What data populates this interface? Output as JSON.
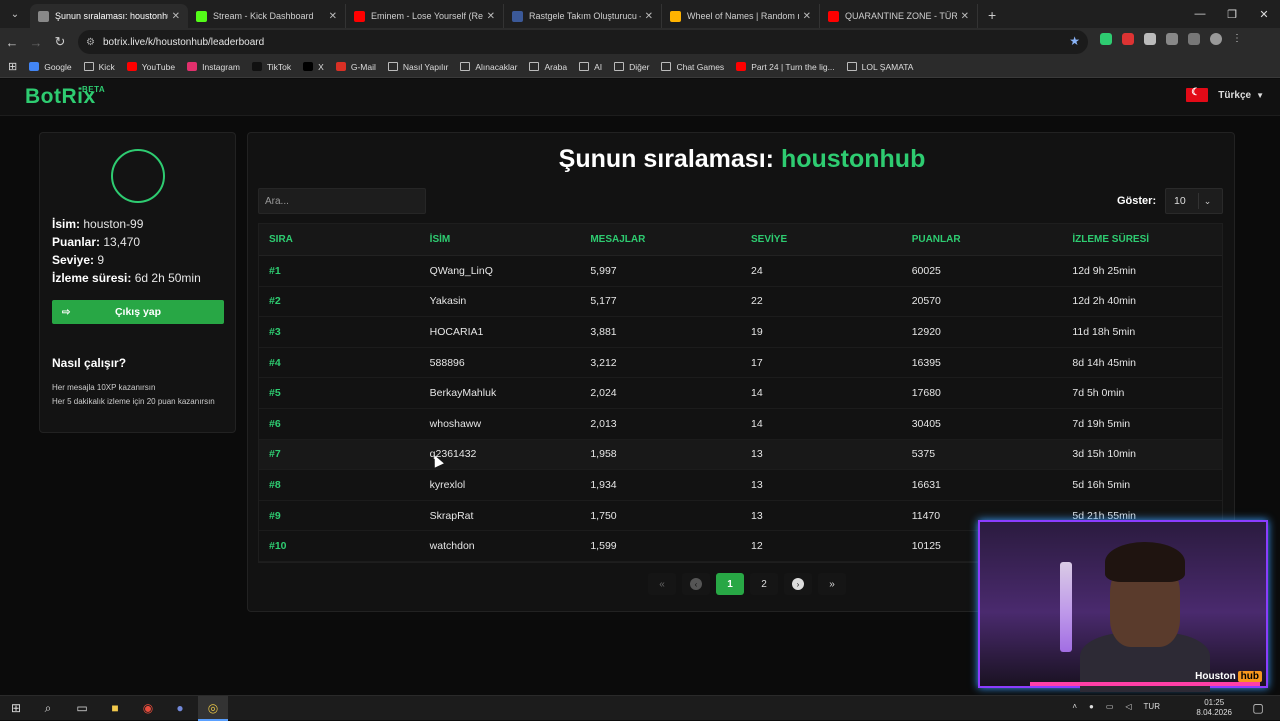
{
  "browser": {
    "tabs": [
      {
        "title": "Şunun sıralaması: houstonhub |",
        "color": "#888888",
        "active": true
      },
      {
        "title": "Stream - Kick Dashboard",
        "color": "#53fc18",
        "active": false
      },
      {
        "title": "Eminem - Lose Yourself (Remix",
        "color": "#ff0000",
        "active": false
      },
      {
        "title": "Rastgele Takım Oluşturucu — B",
        "color": "#3b5998",
        "active": false
      },
      {
        "title": "Wheel of Names | Random nam",
        "color": "#ffb300",
        "active": false
      },
      {
        "title": "QUARANTINE ZONE - TÜRKÇE",
        "color": "#ff0000",
        "active": false
      }
    ],
    "new_tab": "+",
    "url": "botrix.live/k/houstonhub/leaderboard",
    "bookmarks": [
      {
        "label": "Google",
        "color": "#4285f4",
        "folder": false
      },
      {
        "label": "Kick",
        "color": "",
        "folder": true
      },
      {
        "label": "YouTube",
        "color": "#ff0000",
        "folder": false
      },
      {
        "label": "Instagram",
        "color": "#e1306c",
        "folder": false
      },
      {
        "label": "TikTok",
        "color": "#111111",
        "folder": false
      },
      {
        "label": "X",
        "color": "#000000",
        "folder": false
      },
      {
        "label": "G-Mail",
        "color": "#d93025",
        "folder": false
      },
      {
        "label": "Nasıl Yapılır",
        "color": "",
        "folder": true
      },
      {
        "label": "Alınacaklar",
        "color": "",
        "folder": true
      },
      {
        "label": "Araba",
        "color": "",
        "folder": true
      },
      {
        "label": "AI",
        "color": "",
        "folder": true
      },
      {
        "label": "Diğer",
        "color": "",
        "folder": true
      },
      {
        "label": "Chat Games",
        "color": "",
        "folder": true
      },
      {
        "label": "Part 24 | Turn the lig...",
        "color": "#ff0000",
        "folder": false
      },
      {
        "label": "LOL ŞAMATA",
        "color": "",
        "folder": true
      }
    ]
  },
  "site": {
    "logo": "BotRix",
    "logo_badge": "BETA",
    "language": "Türkçe",
    "accent": "#2ecc71"
  },
  "profile": {
    "name_label": "İsim:",
    "name": "houston-99",
    "points_label": "Puanlar:",
    "points": "13,470",
    "level_label": "Seviye:",
    "level": "9",
    "watch_label": "İzleme süresi:",
    "watch": "6d 2h 50min",
    "logout": "Çıkış yap",
    "how_title": "Nasıl çalışır?",
    "how_line1": "Her mesajla 10XP kazanırsın",
    "how_line2": "Her 5 dakikalık izleme için 20 puan kazanırsın"
  },
  "leaderboard": {
    "title_prefix": "Şunun sıralaması:",
    "channel": "houstonhub",
    "search_placeholder": "Ara...",
    "show_label": "Göster:",
    "show_value": "10",
    "headers": [
      "SIRA",
      "İSİM",
      "MESAJLAR",
      "SEVİYE",
      "PUANLAR",
      "İZLEME SÜRESİ"
    ],
    "rows": [
      [
        "#1",
        "QWang_LinQ",
        "5,997",
        "24",
        "60025",
        "12d 9h 25min"
      ],
      [
        "#2",
        "Yakasin",
        "5,177",
        "22",
        "20570",
        "12d 2h 40min"
      ],
      [
        "#3",
        "HOCARIA1",
        "3,881",
        "19",
        "12920",
        "11d 18h 5min"
      ],
      [
        "#4",
        "588896",
        "3,212",
        "17",
        "16395",
        "8d 14h 45min"
      ],
      [
        "#5",
        "BerkayMahluk",
        "2,024",
        "14",
        "17680",
        "7d 5h 0min"
      ],
      [
        "#6",
        "whoshaww",
        "2,013",
        "14",
        "30405",
        "7d 19h 5min"
      ],
      [
        "#7",
        "q2361432",
        "1,958",
        "13",
        "5375",
        "3d 15h 10min"
      ],
      [
        "#8",
        "kyrexlol",
        "1,934",
        "13",
        "16631",
        "5d 16h 5min"
      ],
      [
        "#9",
        "SkrapRat",
        "1,750",
        "13",
        "11470",
        "5d 21h 55min"
      ],
      [
        "#10",
        "watchdon",
        "1,599",
        "12",
        "10125",
        ""
      ]
    ],
    "pagination": {
      "first": "«",
      "prev": "‹",
      "page1": "1",
      "page2": "2",
      "next": "›",
      "last": "»"
    }
  },
  "webcam": {
    "brand_a": "Houston",
    "brand_b": "hub"
  },
  "taskbar": {
    "lang": "TUR",
    "time": "01:25",
    "date": "8.04.2026"
  }
}
